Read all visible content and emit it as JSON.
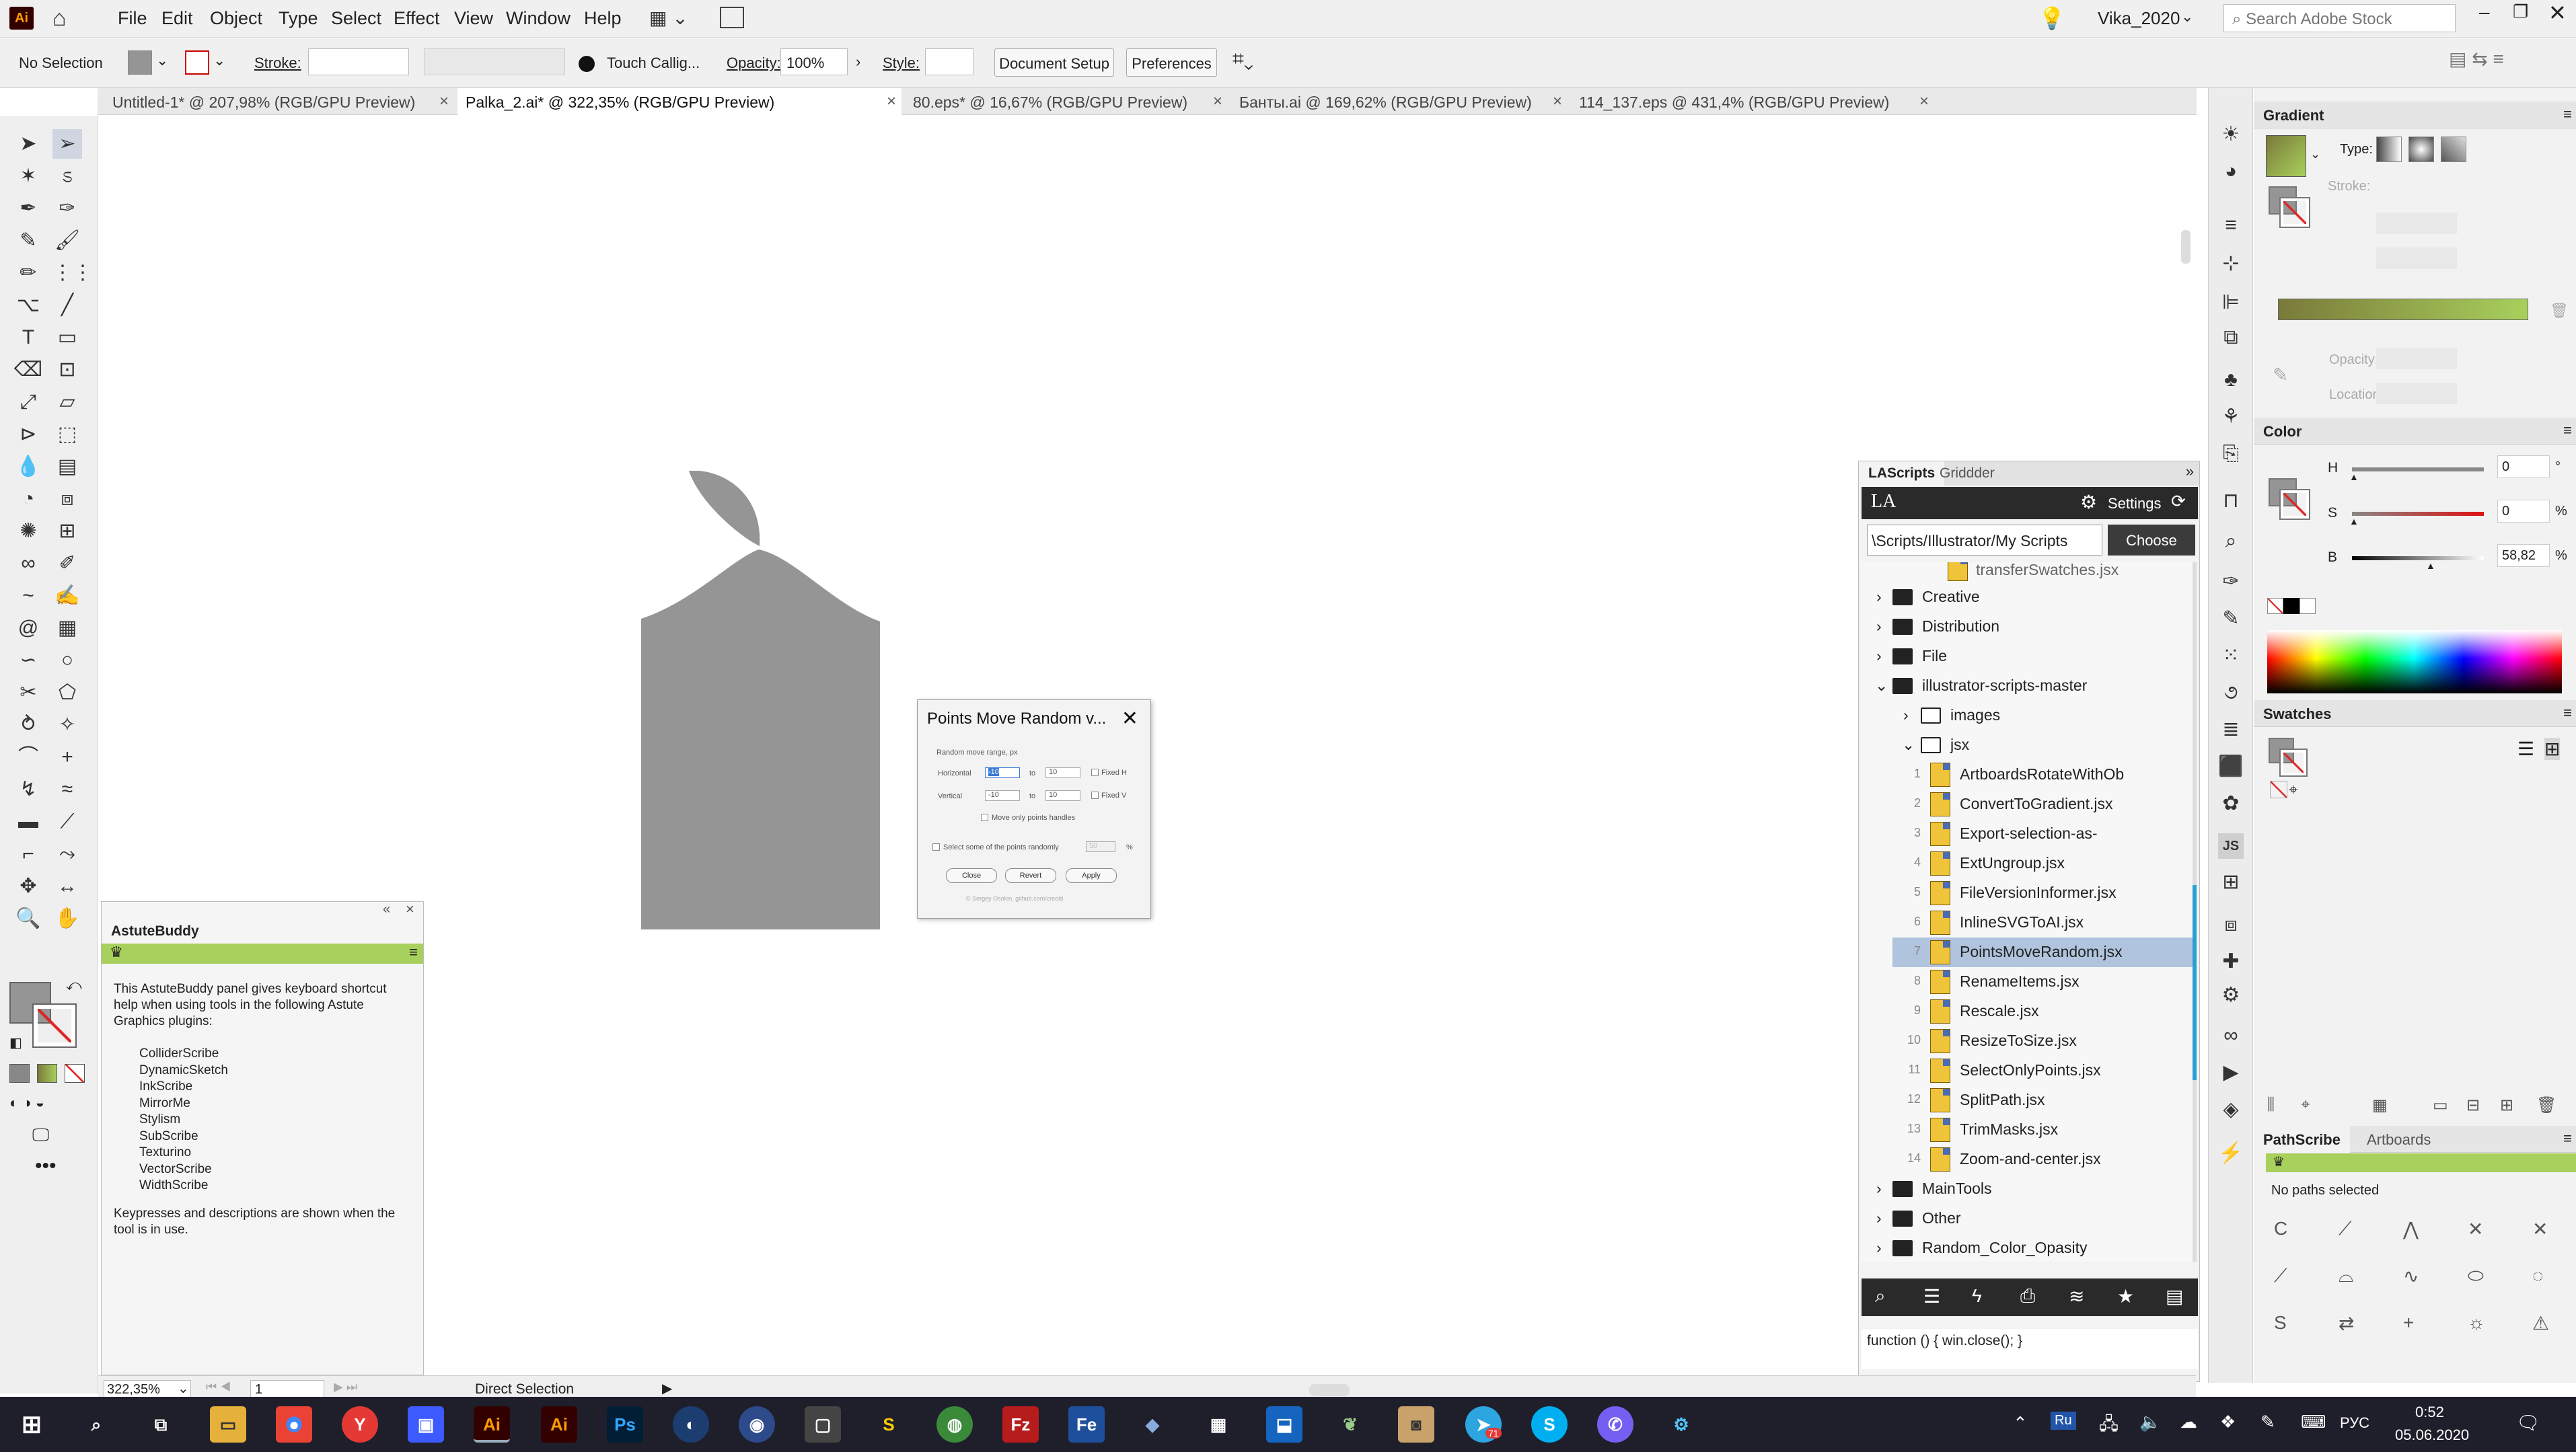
{
  "menubar": {
    "app_logo": "Ai",
    "menus": [
      "File",
      "Edit",
      "Object",
      "Type",
      "Select",
      "Effect",
      "View",
      "Window",
      "Help"
    ],
    "user": "Vika_2020",
    "search_placeholder": "Search Adobe Stock"
  },
  "control": {
    "selection": "No Selection",
    "stroke_label": "Stroke:",
    "brush": "Touch Callig...",
    "opacity_label": "Opacity:",
    "opacity_value": "100%",
    "style_label": "Style:",
    "doc_setup": "Document Setup",
    "preferences": "Preferences"
  },
  "tabs": [
    "Untitled-1* @ 207,98% (RGB/GPU Preview)",
    "Palka_2.ai* @ 322,35% (RGB/GPU Preview)",
    "80.eps* @ 16,67% (RGB/GPU Preview)",
    "Банты.ai @ 169,62% (RGB/GPU Preview)",
    "114_137.eps @ 431,4% (RGB/GPU Preview)"
  ],
  "dialog": {
    "title": "Points Move Random v...",
    "group_label": "Random move range, px",
    "horizontal": "Horizontal",
    "vertical": "Vertical",
    "to": "to",
    "h_from": "-10",
    "h_to": "10",
    "v_from": "-10",
    "v_to": "10",
    "fixed_h": "Fixed H",
    "fixed_v": "Fixed V",
    "move_handles": "Move only points handles",
    "select_some": "Select some of the points randomly",
    "percent_value": "50",
    "percent": "%",
    "close": "Close",
    "revert": "Revert",
    "apply": "Apply",
    "credit": "© Sergey Osokin, github.com/creold"
  },
  "astute": {
    "title": "AstuteBuddy",
    "intro": "This AstuteBuddy panel gives keyboard shortcut help when using tools in the following Astute Graphics plugins:",
    "plugins": [
      "ColliderScribe",
      "DynamicSketch",
      "InkScribe",
      "MirrorMe",
      "Stylism",
      "SubScribe",
      "Texturino",
      "VectorScribe",
      "WidthScribe"
    ],
    "footer": "Keypresses and descriptions are shown when the tool is in use."
  },
  "lascripts": {
    "tab1": "LAScripts",
    "tab2": "Griddder",
    "logo": "LA",
    "settings": "Settings",
    "path": "\\Scripts/Illustrator/My Scripts",
    "choose": "Choose",
    "partial_row": "transferSwatches.jsx",
    "folders_top": [
      "Creative",
      "Distribution",
      "File",
      "illustrator-scripts-master"
    ],
    "sub_folders": [
      "images",
      "jsx"
    ],
    "files": [
      {
        "n": "1",
        "name": "ArtboardsRotateWithOb"
      },
      {
        "n": "2",
        "name": "ConvertToGradient.jsx"
      },
      {
        "n": "3",
        "name": "Export-selection-as-"
      },
      {
        "n": "4",
        "name": "ExtUngroup.jsx"
      },
      {
        "n": "5",
        "name": "FileVersionInformer.jsx"
      },
      {
        "n": "6",
        "name": "InlineSVGToAI.jsx"
      },
      {
        "n": "7",
        "name": "PointsMoveRandom.jsx"
      },
      {
        "n": "8",
        "name": "RenameItems.jsx"
      },
      {
        "n": "9",
        "name": "Rescale.jsx"
      },
      {
        "n": "10",
        "name": "ResizeToSize.jsx"
      },
      {
        "n": "11",
        "name": "SelectOnlyPoints.jsx"
      },
      {
        "n": "12",
        "name": "SplitPath.jsx"
      },
      {
        "n": "13",
        "name": "TrimMasks.jsx"
      },
      {
        "n": "14",
        "name": "Zoom-and-center.jsx"
      }
    ],
    "selected_index": 6,
    "folders_bottom": [
      "MainTools",
      "Other",
      "Random_Color_Opasity"
    ],
    "code": "function () { win.close(); }"
  },
  "gradient": {
    "title": "Gradient",
    "type_label": "Type:",
    "stroke_label": "Stroke:",
    "opacity_label": "Opacity:",
    "location_label": "Location:"
  },
  "color": {
    "title": "Color",
    "h_label": "H",
    "h_value": "0",
    "h_unit": "°",
    "s_label": "S",
    "s_value": "0",
    "s_unit": "%",
    "b_label": "B",
    "b_value": "58,82",
    "b_unit": "%"
  },
  "swatches": {
    "title": "Swatches"
  },
  "pathscribe": {
    "tab1": "PathScribe",
    "tab2": "Artboards",
    "status": "No paths selected"
  },
  "status": {
    "zoom": "322,35%",
    "artboard": "1",
    "tool": "Direct Selection"
  },
  "taskbar": {
    "lang": "РУС",
    "time": "0:52",
    "date": "05.06.2020",
    "ru": "Ru",
    "telegram_badge": "71"
  },
  "colors": {
    "shape": "#959595",
    "accent_green": "#a8d05c",
    "selected_row": "#b0c4de",
    "taskbar": "#1f1f2b"
  }
}
